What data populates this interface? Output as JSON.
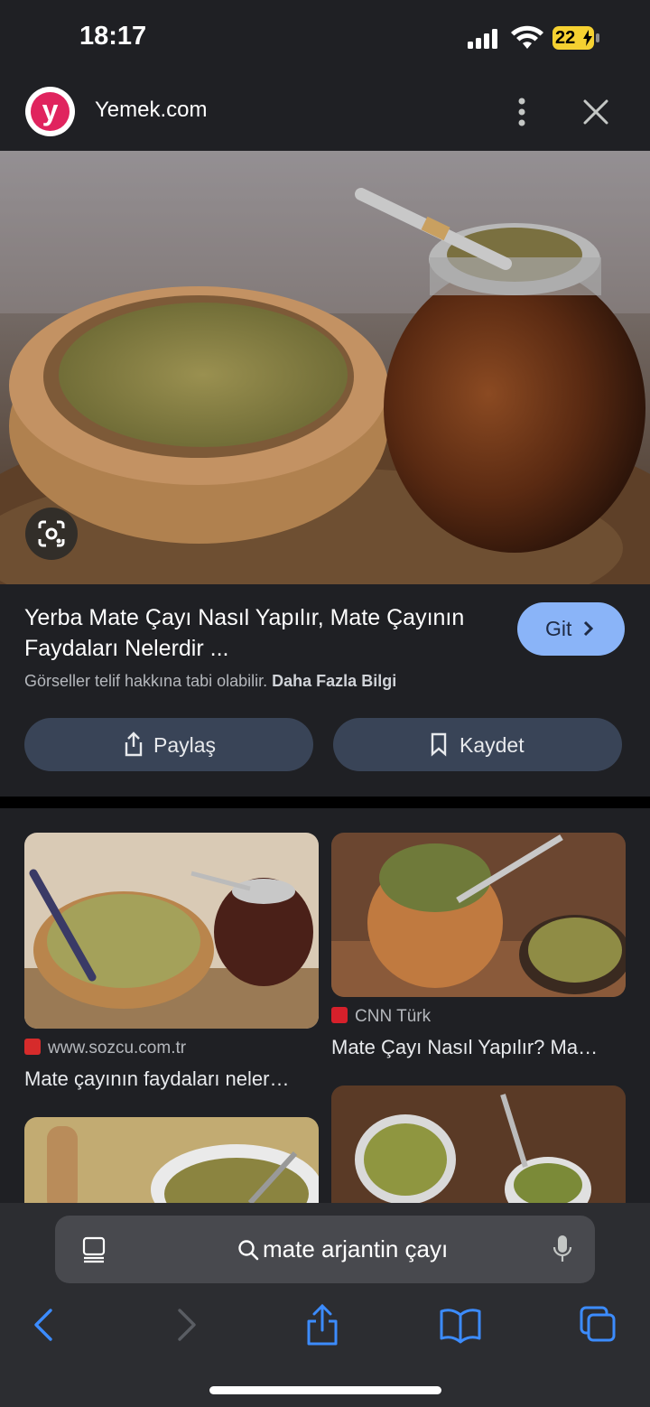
{
  "status_bar": {
    "time": "18:17",
    "battery": "22"
  },
  "header": {
    "site_name": "Yemek.com",
    "logo_letter": "y"
  },
  "result": {
    "title": "Yerba Mate Çayı Nasıl Yapılır, Mate Çayının Faydaları Nelerdir ...",
    "go_label": "Git",
    "copyright_note": "Görseller telif hakkına tabi olabilir.",
    "more_info": "Daha Fazla Bilgi",
    "share_label": "Paylaş",
    "save_label": "Kaydet"
  },
  "related": [
    {
      "source": "www.sozcu.com.tr",
      "caption": "Mate çayının faydaları neler…"
    },
    {
      "source": "CNN Türk",
      "caption": "Mate Çayı Nasıl Yapılır? Ma…"
    }
  ],
  "search": {
    "query": "mate arjantin çayı"
  },
  "colors": {
    "accent": "#8ab4f8",
    "brand": "#e0245e",
    "background": "#1f2024"
  }
}
